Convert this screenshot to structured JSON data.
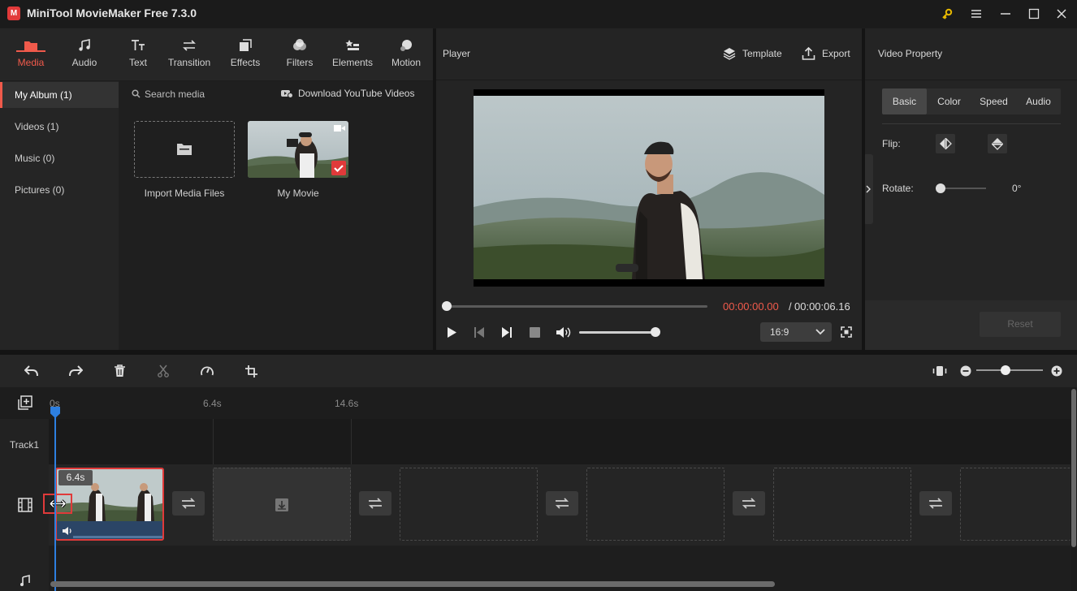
{
  "app": {
    "title": "MiniTool MovieMaker Free 7.3.0",
    "logo_letter": "M"
  },
  "toolbar": {
    "items": [
      {
        "label": "Media",
        "icon": "folder-icon"
      },
      {
        "label": "Audio",
        "icon": "music-note-icon"
      },
      {
        "label": "Text",
        "icon": "text-icon"
      },
      {
        "label": "Transition",
        "icon": "transition-icon"
      },
      {
        "label": "Effects",
        "icon": "effects-icon"
      },
      {
        "label": "Filters",
        "icon": "filters-icon"
      },
      {
        "label": "Elements",
        "icon": "elements-icon"
      },
      {
        "label": "Motion",
        "icon": "motion-icon"
      }
    ],
    "active": "Media"
  },
  "album": {
    "items": [
      "My Album (1)",
      "Videos (1)",
      "Music (0)",
      "Pictures (0)"
    ],
    "active": "My Album (1)"
  },
  "media": {
    "search_placeholder": "Search media",
    "download_label": "Download YouTube Videos",
    "import_label": "Import Media Files",
    "clip_label": "My Movie"
  },
  "player": {
    "title": "Player",
    "template_label": "Template",
    "export_label": "Export",
    "current_time": "00:00:00.00",
    "separator": "/",
    "total_time": "00:00:06.16",
    "aspect_ratio": "16:9"
  },
  "property": {
    "title": "Video Property",
    "tabs": [
      "Basic",
      "Color",
      "Speed",
      "Audio"
    ],
    "active_tab": "Basic",
    "flip_label": "Flip:",
    "rotate_label": "Rotate:",
    "rotate_value": "0°",
    "reset_label": "Reset"
  },
  "timeline": {
    "ruler": [
      "0s",
      "6.4s",
      "14.6s"
    ],
    "track1_label": "Track1",
    "clip_duration": "6.4s"
  },
  "colors": {
    "accent": "#f05a4b",
    "playhead": "#2d7fe0",
    "selection": "#e03a3a"
  }
}
